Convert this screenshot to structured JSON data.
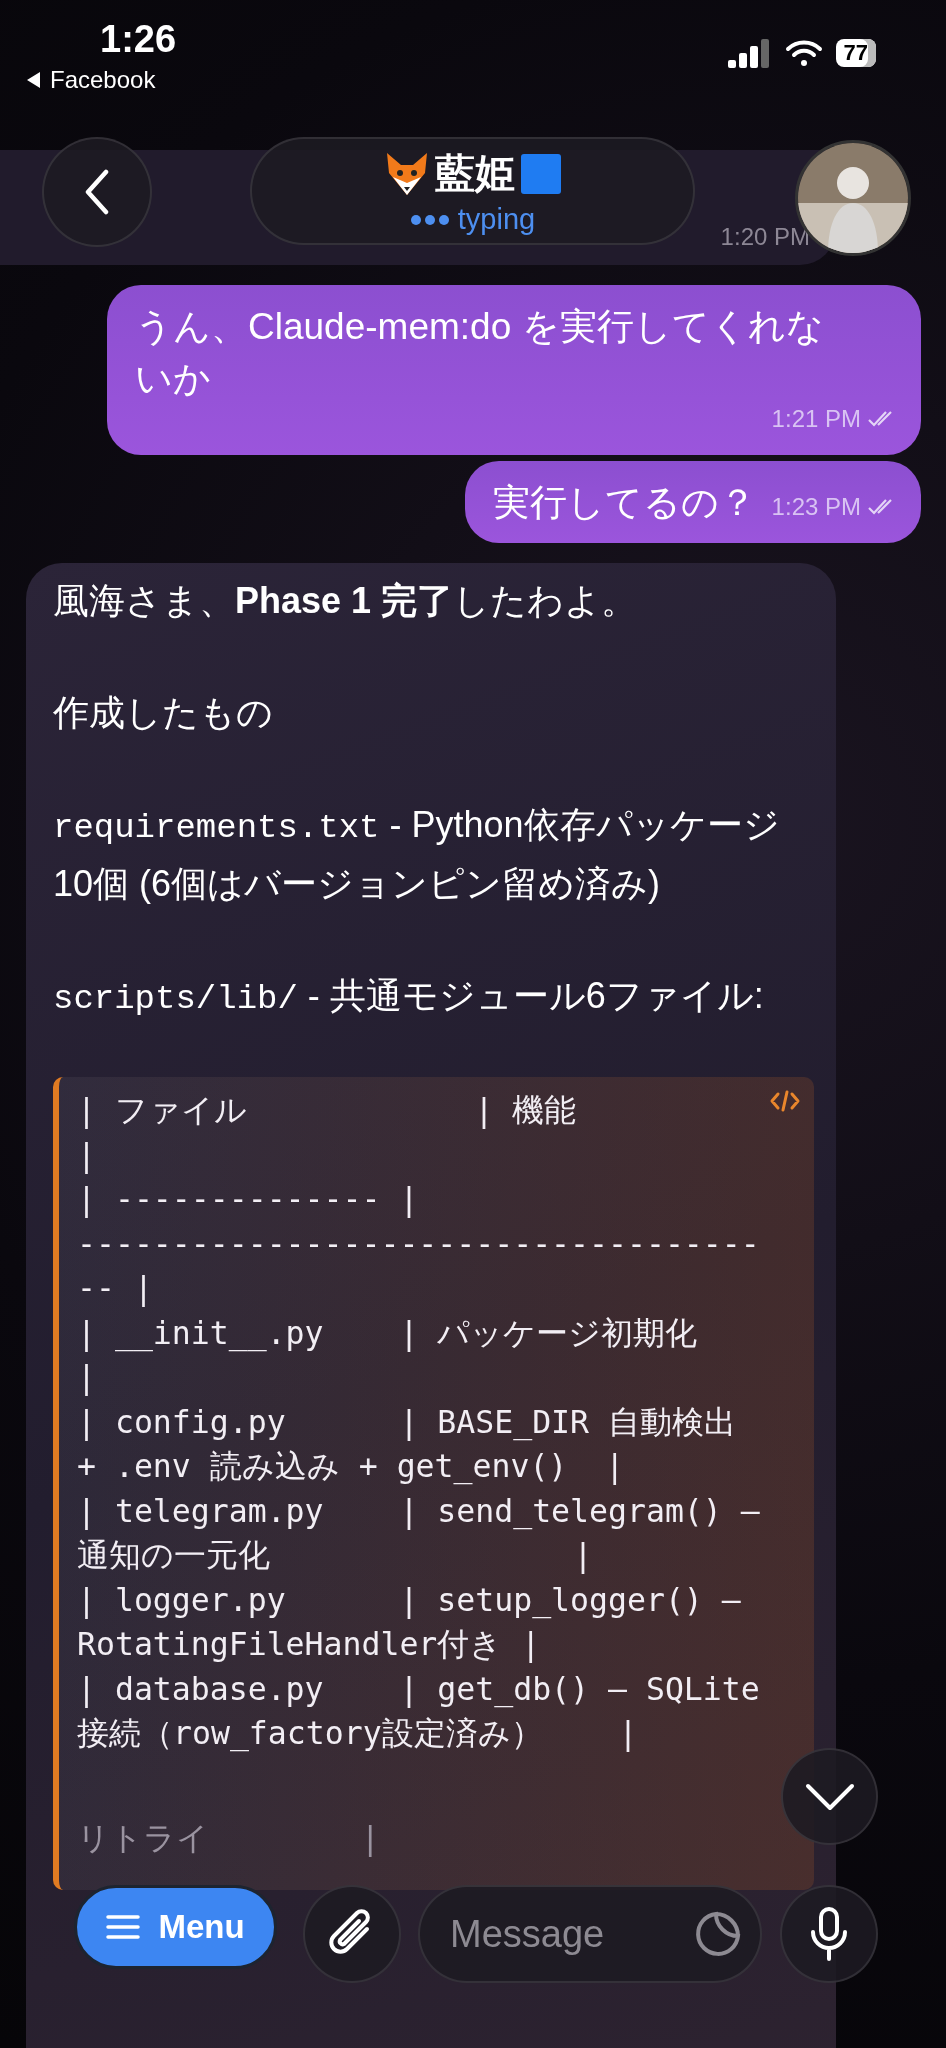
{
  "status_bar": {
    "time": "1:26",
    "back_link": "Facebook",
    "battery": "77"
  },
  "header": {
    "title": "藍姫",
    "status": "typing"
  },
  "messages": [
    {
      "kind": "stub",
      "time": "1:20 PM"
    },
    {
      "kind": "outgoing",
      "text": "うん、Claude-mem:do を実行してくれないか",
      "time": "1:21 PM",
      "read": true
    },
    {
      "kind": "outgoing",
      "text": "実行してるの？",
      "time": "1:23 PM",
      "read": true
    },
    {
      "kind": "incoming",
      "paragraphs": [
        {
          "text": "風海さま、**Phase 1 完了**したわよ。"
        },
        {
          "text": "作成したもの"
        },
        {
          "code": "requirements.txt",
          "text": " - Python依存パッケージ10個 (6個はバージョンピン留め済み)"
        },
        {
          "code": "scripts/lib/",
          "text": " - 共通モジュール6ファイル:"
        }
      ],
      "code_block": {
        "lines": [
          "| ファイル            | 機能",
          "|",
          "| -------------- |",
          "------------------------------------",
          "-- |",
          "| __init__.py    | パッケージ初期化",
          "|",
          "| config.py      | BASE_DIR 自動検出",
          "+ .env 読み込み + get_env()  |",
          "| telegram.py    | send_telegram() –",
          "通知の一元化                |",
          "| logger.py      | setup_logger() –",
          "RotatingFileHandler付き |",
          "| database.py    | get_db() – SQLite",
          "接続（row_factory設定済み）    |",
          "リトライ        |"
        ]
      }
    }
  ],
  "composer": {
    "menu_label": "Menu",
    "placeholder": "Message"
  }
}
